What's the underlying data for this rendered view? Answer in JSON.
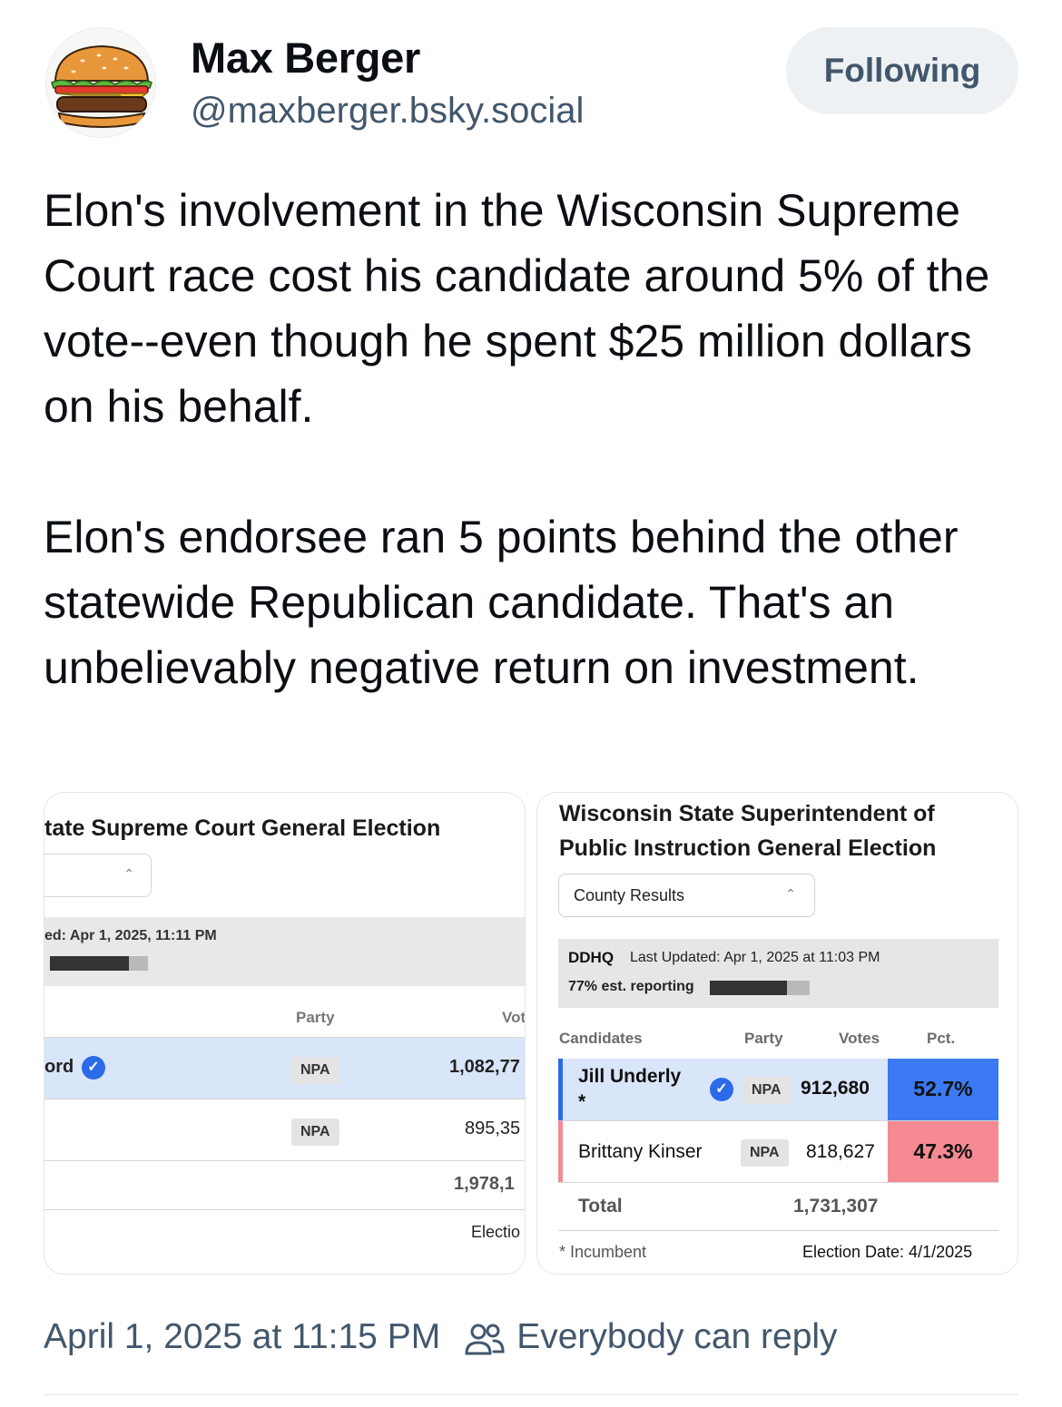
{
  "author": {
    "display_name": "Max Berger",
    "handle": "@maxberger.bsky.social",
    "avatar_icon": "burger-avatar-icon"
  },
  "follow_button": {
    "label": "Following"
  },
  "post": {
    "paragraphs": [
      "Elon's involvement in the Wisconsin Supreme Court race cost his candidate around 5% of the vote--even though he spent $25 million dollars on his behalf.",
      "Elon's endorsee ran 5 points behind the other statewide Republican candidate. That's an unbelievably negative return on investment."
    ]
  },
  "embed_left": {
    "title": "tate Supreme Court General Election",
    "updated": "ed: Apr 1, 2025, 11:11 PM",
    "reporting_fraction": 0.81,
    "header_party": "Party",
    "header_votes": "Vot",
    "rows": [
      {
        "name": "ord",
        "party": "NPA",
        "votes": "1,082,77",
        "winner": true
      },
      {
        "name": "",
        "party": "NPA",
        "votes": "895,35",
        "winner": false
      }
    ],
    "total_votes": "1,978,1",
    "footer": "Electio"
  },
  "embed_right": {
    "title": "Wisconsin State Superintendent of Public Instruction General Election",
    "select_label": "County Results",
    "brand": "DDHQ",
    "updated": "Last Updated: Apr 1, 2025 at 11:03 PM",
    "reporting": "77% est. reporting",
    "reporting_fraction": 0.77,
    "headers": {
      "candidates": "Candidates",
      "party": "Party",
      "votes": "Votes",
      "pct": "Pct."
    },
    "rows": [
      {
        "name": "Jill Underly",
        "incumbent_mark": "*",
        "party": "NPA",
        "votes": "912,680",
        "pct": "52.7%",
        "winner": true,
        "color": "#3b7af2"
      },
      {
        "name": "Brittany Kinser",
        "incumbent_mark": "",
        "party": "NPA",
        "votes": "818,627",
        "pct": "47.3%",
        "winner": false,
        "color": "#f58a92"
      }
    ],
    "total_label": "Total",
    "total_votes": "1,731,307",
    "footnote": "* Incumbent",
    "election_date": "Election Date: 4/1/2025"
  },
  "meta": {
    "timestamp": "April 1, 2025 at 11:15 PM",
    "reply_setting": "Everybody can reply",
    "reply_icon": "people-icon"
  }
}
